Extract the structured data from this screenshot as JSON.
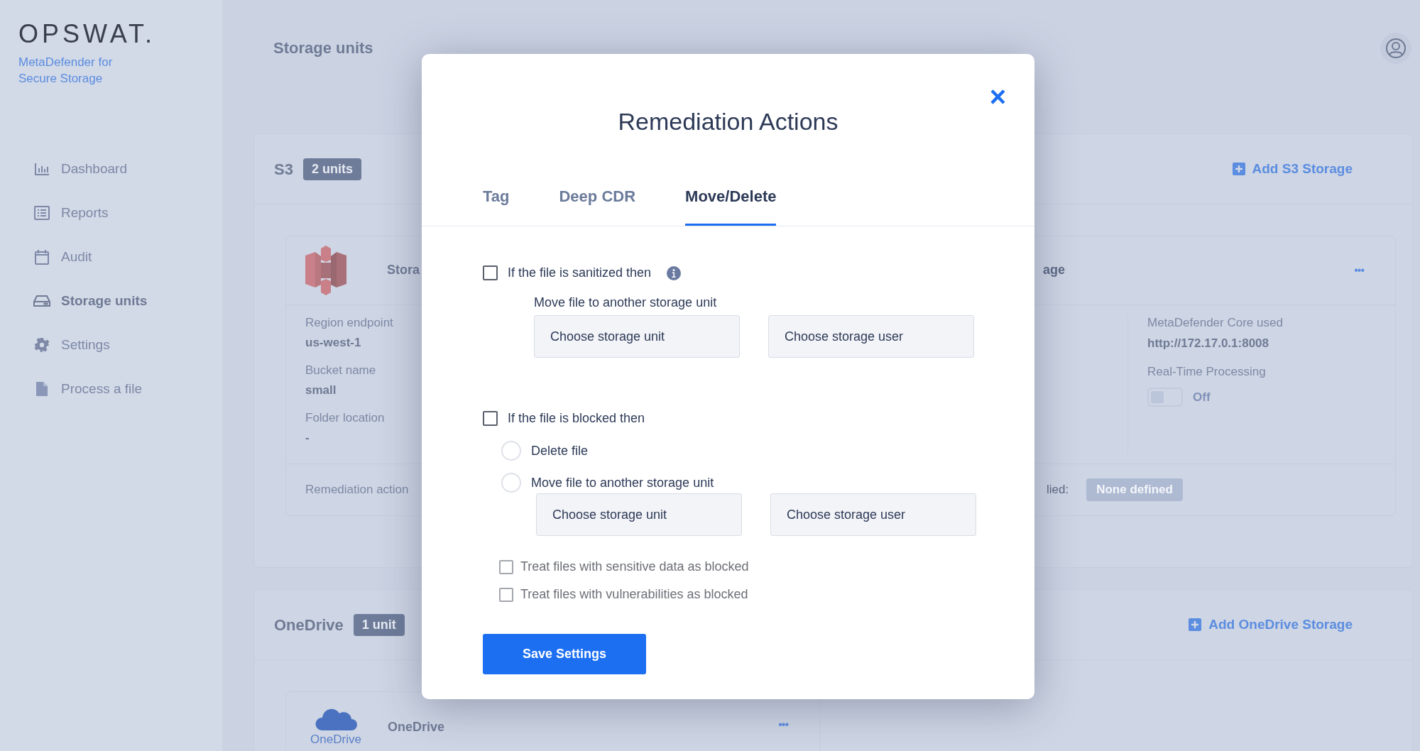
{
  "sidebar": {
    "logo": "OPSWAT.",
    "product": "MetaDefender for Secure Storage",
    "items": [
      {
        "label": "Dashboard",
        "selected": false
      },
      {
        "label": "Reports",
        "selected": false
      },
      {
        "label": "Audit",
        "selected": false
      },
      {
        "label": "Storage units",
        "selected": true
      },
      {
        "label": "Settings",
        "selected": false
      },
      {
        "label": "Process a file",
        "selected": false
      }
    ]
  },
  "page_title": "Storage units",
  "s3": {
    "title": "S3",
    "badge": "2 units",
    "add_link": "Add S3 Storage",
    "card_left": {
      "name": "Stora",
      "fields": [
        {
          "label": "Region endpoint",
          "value": "us-west-1"
        },
        {
          "label": "Bucket name",
          "value": "small"
        },
        {
          "label": "Folder location",
          "value": "-"
        }
      ],
      "footer_label": "Remediation action"
    },
    "card_right": {
      "name": "age",
      "menu": "•••",
      "core_label": "MetaDefender Core used",
      "core_value": "http://172.17.0.1:8008",
      "realtime_label": "Real-Time Processing",
      "realtime_on": false,
      "realtime_text": "Off",
      "footer_label": "lied:",
      "footer_badge": "None defined"
    }
  },
  "onedrive": {
    "title": "OneDrive",
    "badge": "1 unit",
    "add_link": "Add OneDrive Storage",
    "card": {
      "logo_caption": "OneDrive",
      "name": "OneDrive",
      "menu": "•••"
    }
  },
  "modal": {
    "title": "Remediation Actions",
    "close": "×",
    "tabs": [
      {
        "label": "Tag",
        "selected": false
      },
      {
        "label": "Deep CDR",
        "selected": false
      },
      {
        "label": "Move/Delete",
        "selected": true
      }
    ],
    "sanitized": {
      "label": "If the file is sanitized then",
      "checked": false,
      "sublabel": "Move file to another storage unit",
      "unit_select": "Choose storage unit",
      "user_select": "Choose storage user"
    },
    "blocked": {
      "label": "If the file is blocked then",
      "checked": false,
      "options": [
        {
          "label": "Delete file",
          "selected": false
        },
        {
          "label": "Move file to another storage unit",
          "selected": false
        }
      ],
      "unit_select": "Choose storage unit",
      "user_select": "Choose storage user"
    },
    "extra_checks": [
      {
        "label": "Treat files with sensitive data as blocked",
        "checked": false
      },
      {
        "label": "Treat files with vulnerabilities as blocked",
        "checked": false
      }
    ],
    "save": "Save Settings"
  }
}
